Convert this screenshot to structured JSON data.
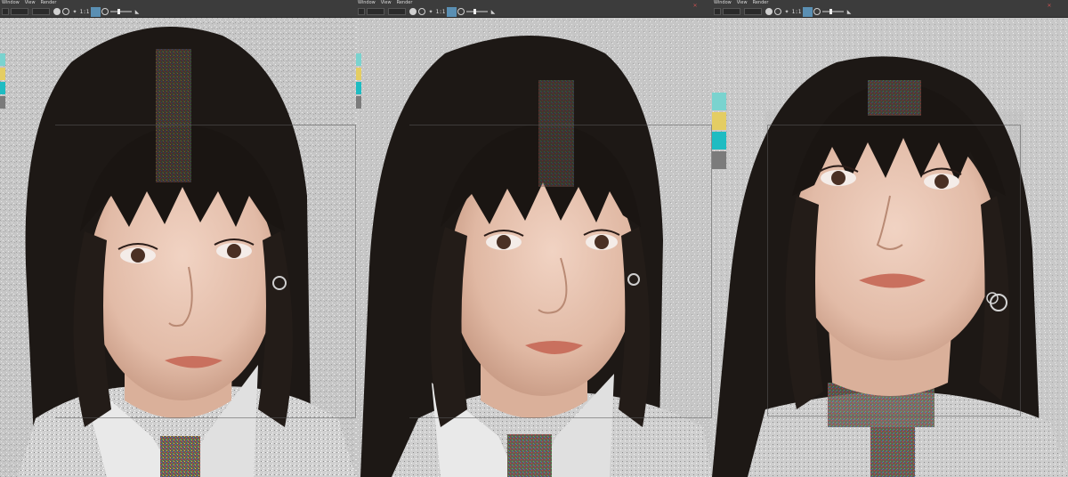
{
  "menus": [
    "Window",
    "View",
    "Render"
  ],
  "toolbar": {
    "ratio_label": "1:1"
  },
  "panels": [
    {
      "id": "front-view"
    },
    {
      "id": "three-quarter-view"
    },
    {
      "id": "upward-view"
    }
  ],
  "colors": {
    "toolbar_bg": "#3c3c3c",
    "viewport_bg": "#c9c9c9",
    "highlight": "#5a8fb3",
    "hair": "#1a1512",
    "skin": "#e9c8b6",
    "jacket": "#d4d4d4"
  },
  "color_checker": [
    "#7ad3cf",
    "#e4cd63",
    "#1fbcc2",
    "#7b7b7b"
  ]
}
